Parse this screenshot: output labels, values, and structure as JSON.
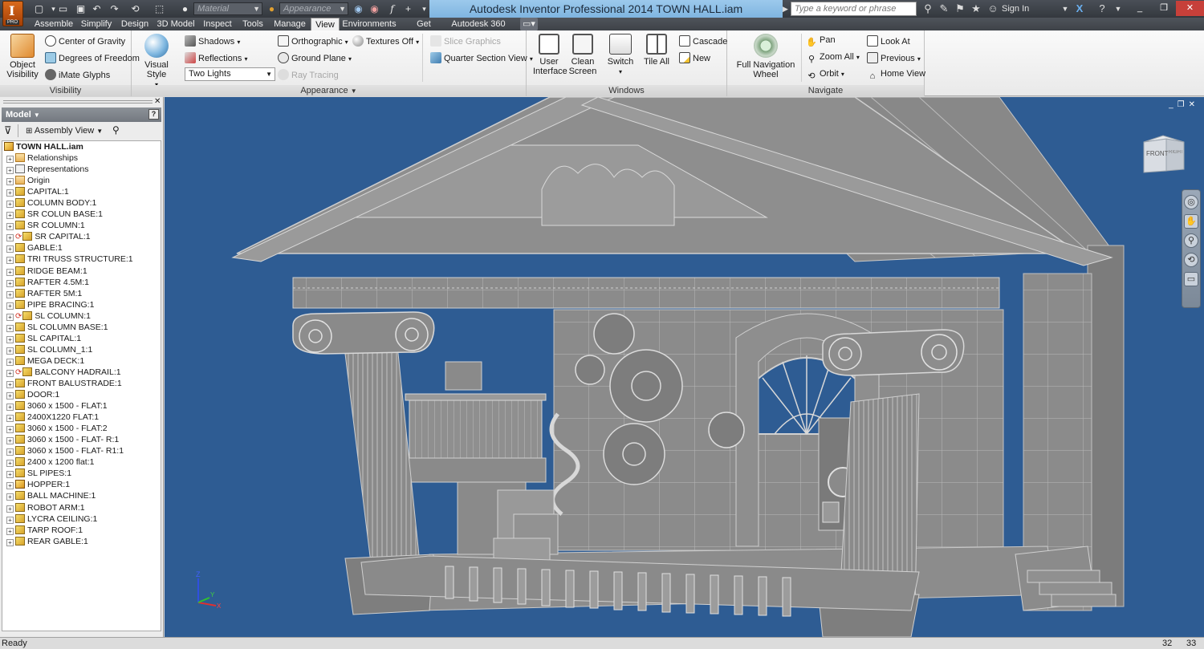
{
  "titlebar": {
    "title": "Autodesk Inventor Professional 2014    TOWN HALL.iam",
    "logo_letter": "I",
    "logo_badge": "PRO",
    "material_placeholder": "Material",
    "appearance_placeholder": "Appearance",
    "search_placeholder": "Type a keyword or phrase",
    "sign_in": "Sign In",
    "accent_color": "#8cc0e8"
  },
  "tabs": [
    "Assemble",
    "Simplify",
    "Design",
    "3D Model",
    "Inspect",
    "Tools",
    "Manage",
    "View",
    "Environments",
    "Get Started",
    "Autodesk 360"
  ],
  "active_tab": "View",
  "ribbon": {
    "visibility": {
      "title": "Visibility",
      "object_visibility": "Object\nVisibility",
      "center_of_gravity": "Center of Gravity",
      "degrees_of_freedom": "Degrees of Freedom",
      "imate_glyphs": "iMate Glyphs"
    },
    "appearance": {
      "title": "Appearance",
      "visual_style": "Visual Style",
      "shadows": "Shadows",
      "reflections": "Reflections",
      "lighting": "Two Lights",
      "orthographic": "Orthographic",
      "ground_plane": "Ground Plane",
      "ray_tracing": "Ray Tracing",
      "textures_off": "Textures Off",
      "slice_graphics": "Slice Graphics",
      "quarter_section_view": "Quarter Section View"
    },
    "windows": {
      "title": "Windows",
      "user_interface": "User\nInterface",
      "clean_screen": "Clean\nScreen",
      "switch": "Switch",
      "tile_all": "Tile All",
      "cascade": "Cascade",
      "new": "New"
    },
    "navigate": {
      "title": "Navigate",
      "full_navigation_wheel": "Full Navigation\nWheel",
      "pan": "Pan",
      "zoom_all": "Zoom All",
      "orbit": "Orbit",
      "look_at": "Look At",
      "previous": "Previous",
      "home_view": "Home View"
    }
  },
  "browser": {
    "header": "Model",
    "view_mode": "Assembly View",
    "root": "TOWN HALL.iam",
    "items": [
      {
        "label": "Relationships",
        "icon": "folder-icon",
        "sync": false
      },
      {
        "label": "Representations",
        "icon": "representations-icon",
        "sync": false
      },
      {
        "label": "Origin",
        "icon": "folder-icon",
        "sync": false
      },
      {
        "label": "CAPITAL:1",
        "icon": "part-icon",
        "sync": false
      },
      {
        "label": "COLUMN BODY:1",
        "icon": "part-icon",
        "sync": false
      },
      {
        "label": "SR COLUN BASE:1",
        "icon": "part-icon",
        "sync": false
      },
      {
        "label": "SR COLUMN:1",
        "icon": "part-icon",
        "sync": false
      },
      {
        "label": "SR CAPITAL:1",
        "icon": "part-icon",
        "sync": true
      },
      {
        "label": "GABLE:1",
        "icon": "part-icon",
        "sync": false
      },
      {
        "label": "TRI TRUSS STRUCTURE:1",
        "icon": "part-icon",
        "sync": false
      },
      {
        "label": "RIDGE BEAM:1",
        "icon": "part-icon",
        "sync": false
      },
      {
        "label": "RAFTER 4.5M:1",
        "icon": "part-icon",
        "sync": false
      },
      {
        "label": "RAFTER 5M:1",
        "icon": "part-icon",
        "sync": false
      },
      {
        "label": "PIPE BRACING:1",
        "icon": "part-icon",
        "sync": false
      },
      {
        "label": "SL COLUMN:1",
        "icon": "part-icon",
        "sync": true
      },
      {
        "label": "SL COLUMN BASE:1",
        "icon": "part-icon",
        "sync": false
      },
      {
        "label": "SL CAPITAL:1",
        "icon": "part-icon",
        "sync": false
      },
      {
        "label": "SL COLUMN_1:1",
        "icon": "part-icon",
        "sync": false
      },
      {
        "label": "MEGA DECK:1",
        "icon": "part-icon",
        "sync": false
      },
      {
        "label": "BALCONY HADRAIL:1",
        "icon": "part-icon",
        "sync": true
      },
      {
        "label": "FRONT BALUSTRADE:1",
        "icon": "part-icon",
        "sync": false
      },
      {
        "label": "DOOR:1",
        "icon": "part-icon",
        "sync": false
      },
      {
        "label": "3060 x 1500 - FLAT:1",
        "icon": "part-icon",
        "sync": false
      },
      {
        "label": "2400X1220 FLAT:1",
        "icon": "part-icon",
        "sync": false
      },
      {
        "label": "3060 x 1500 - FLAT:2",
        "icon": "part-icon",
        "sync": false
      },
      {
        "label": "3060 x 1500 - FLAT- R:1",
        "icon": "part-icon",
        "sync": false
      },
      {
        "label": "3060 x 1500 - FLAT- R1:1",
        "icon": "part-icon",
        "sync": false
      },
      {
        "label": "2400 x 1200 flat:1",
        "icon": "part-icon",
        "sync": false
      },
      {
        "label": "SL PIPES:1",
        "icon": "part-icon",
        "sync": false
      },
      {
        "label": "HOPPER:1",
        "icon": "assembly-icon",
        "sync": false
      },
      {
        "label": "BALL MACHINE:1",
        "icon": "part-icon",
        "sync": false
      },
      {
        "label": "ROBOT ARM:1",
        "icon": "part-icon",
        "sync": false
      },
      {
        "label": "LYCRA CEILING:1",
        "icon": "part-icon",
        "sync": false
      },
      {
        "label": "TARP ROOF:1",
        "icon": "part-icon",
        "sync": false
      },
      {
        "label": "REAR GABLE:1",
        "icon": "part-icon",
        "sync": false
      }
    ]
  },
  "viewport": {
    "background_color": "#2e5c93",
    "viewcube_front": "FRONT",
    "viewcube_right": "RIGHT",
    "triad_z": "Z",
    "triad_x": "X",
    "triad_y": "Y"
  },
  "statusbar": {
    "text": "Ready",
    "num1": "32",
    "num2": "33"
  }
}
